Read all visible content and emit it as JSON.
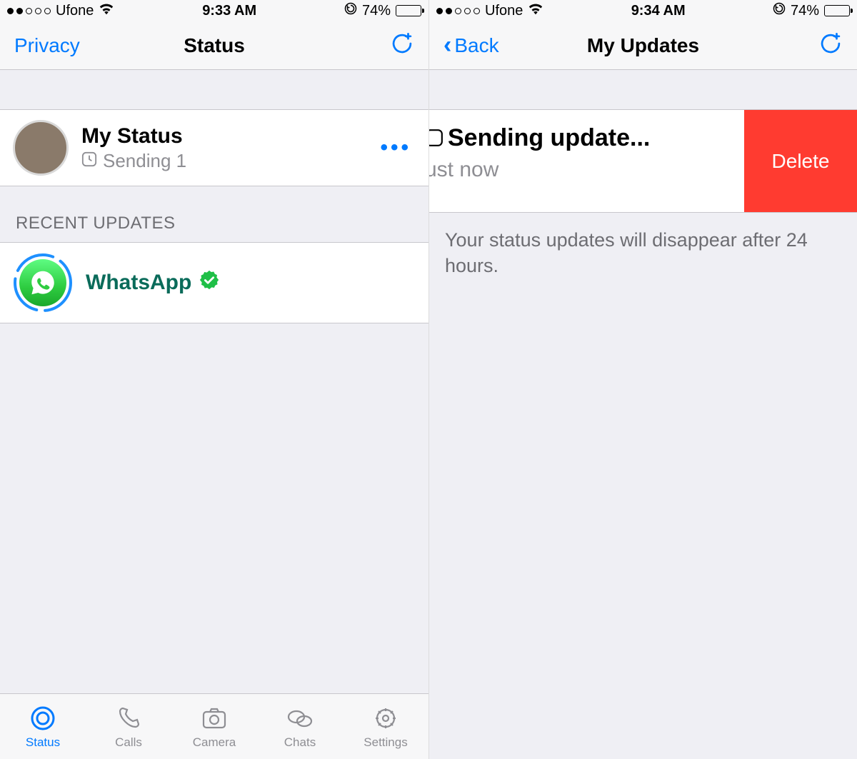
{
  "left": {
    "statusbar": {
      "carrier": "Ufone",
      "time": "9:33 AM",
      "battery_pct": "74%"
    },
    "nav": {
      "left": "Privacy",
      "title": "Status"
    },
    "mystatus": {
      "title": "My Status",
      "subtitle": "Sending 1"
    },
    "section_header": "RECENT UPDATES",
    "recent": {
      "name": "WhatsApp"
    },
    "tabs": {
      "status": "Status",
      "calls": "Calls",
      "camera": "Camera",
      "chats": "Chats",
      "settings": "Settings"
    }
  },
  "right": {
    "statusbar": {
      "carrier": "Ufone",
      "time": "9:34 AM",
      "battery_pct": "74%"
    },
    "nav": {
      "back": "Back",
      "title": "My Updates"
    },
    "row": {
      "title": "Sending update...",
      "subtitle": "ust now",
      "delete": "Delete"
    },
    "footer": "Your status updates will disappear after 24 hours."
  }
}
